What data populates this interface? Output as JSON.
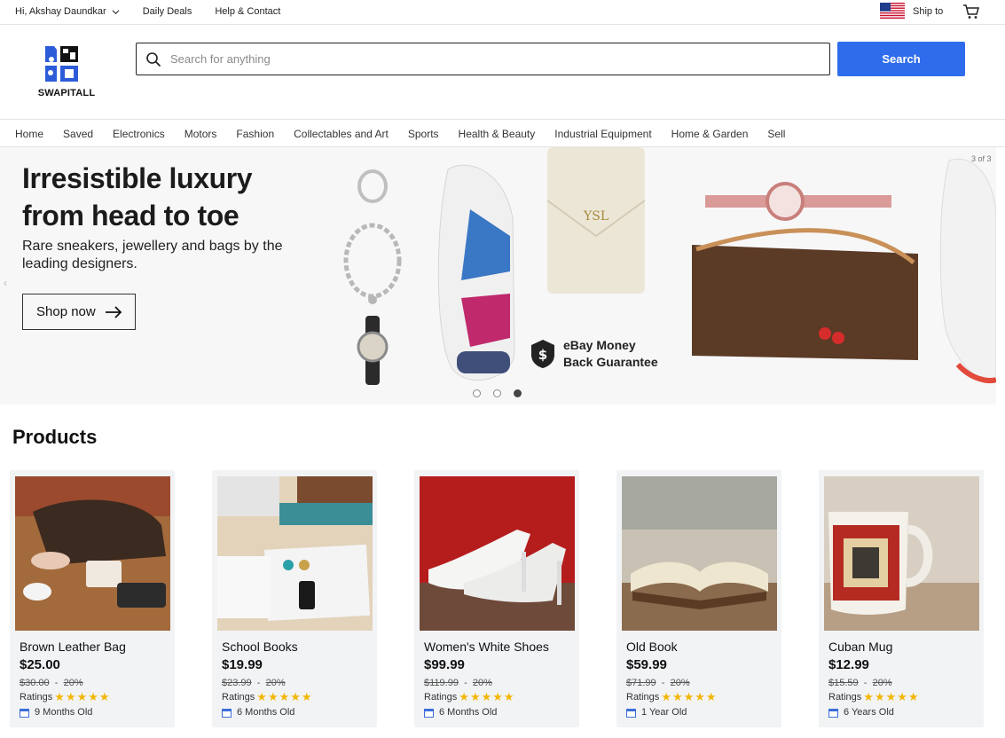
{
  "topbar": {
    "greeting": "Hi, Akshay Daundkar",
    "daily_deals": "Daily Deals",
    "help_contact": "Help & Contact",
    "ship_to": "Ship to"
  },
  "header": {
    "logo_text": "SWAPITALL",
    "search_placeholder": "Search for anything",
    "search_value": "",
    "search_button": "Search"
  },
  "nav": {
    "items": [
      "Home",
      "Saved",
      "Electronics",
      "Motors",
      "Fashion",
      "Collectables and Art",
      "Sports",
      "Health & Beauty",
      "Industrial Equipment",
      "Home & Garden",
      "Sell"
    ]
  },
  "banner": {
    "title": "Irresistible luxury from head to toe",
    "subtitle": "Rare sneakers, jewellery and bags by the leading designers.",
    "cta": "Shop now",
    "slide_counter": "3 of 3",
    "guarantee_line1": "eBay Money",
    "guarantee_line2": "Back Guarantee",
    "active_slide": 3,
    "total_slides": 3
  },
  "products": {
    "title": "Products",
    "ratings_label": "Ratings",
    "discount_sep": "-",
    "items": [
      {
        "name": "Brown Leather Bag",
        "price": "$25.00",
        "old_price": "$30.00",
        "discount": "20%",
        "age": "9 Months Old",
        "rating": 5
      },
      {
        "name": "School Books",
        "price": "$19.99",
        "old_price": "$23.99",
        "discount": "20%",
        "age": "6 Months Old",
        "rating": 5
      },
      {
        "name": "Women's White Shoes",
        "price": "$99.99",
        "old_price": "$119.99",
        "discount": "20%",
        "age": "6 Months Old",
        "rating": 5
      },
      {
        "name": "Old Book",
        "price": "$59.99",
        "old_price": "$71.99",
        "discount": "20%",
        "age": "1 Year Old",
        "rating": 5
      },
      {
        "name": "Cuban Mug",
        "price": "$12.99",
        "old_price": "$15.59",
        "discount": "20%",
        "age": "6 Years Old",
        "rating": 5
      }
    ]
  },
  "colors": {
    "accent": "#2f6ceb",
    "star": "#f2b706",
    "card_bg": "#f2f3f5"
  },
  "icons": [
    "chevron-down-icon",
    "us-flag-icon",
    "cart-icon",
    "search-icon",
    "arrow-right-icon",
    "calendar-icon",
    "star-icon",
    "dollar-shield-icon"
  ]
}
